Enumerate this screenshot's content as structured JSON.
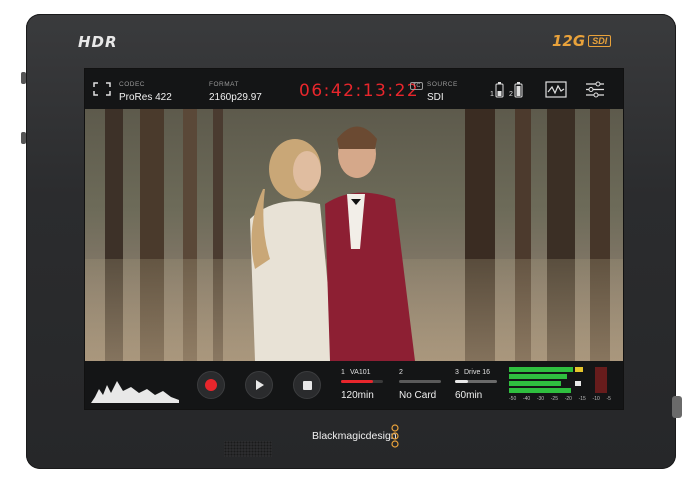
{
  "device": {
    "hdr_label": "HDR",
    "badge_12g": "12G",
    "badge_sdi": "SDI",
    "brand_name": "Blackmagicdesign"
  },
  "topbar": {
    "codec_label": "CODEC",
    "codec_value": "ProRes 422",
    "format_label": "FORMAT",
    "format_value": "2160p29.97",
    "timecode": "06:42:13:22",
    "tc_badge": "TC",
    "source_label": "SOURCE",
    "source_value": "SDI",
    "battery_1": "1",
    "battery_2": "2",
    "icons": [
      "fullscreen-icon",
      "battery-icon",
      "scope-icon",
      "settings-sliders-icon"
    ]
  },
  "transport": {
    "icons": [
      "record-icon",
      "play-icon",
      "stop-icon"
    ],
    "record_color": "#e8262c"
  },
  "slots": [
    {
      "number": "1",
      "name": "VA101",
      "time": "120min",
      "bar_color": "#e8262c",
      "fill": 0.75
    },
    {
      "number": "2",
      "name": "",
      "time": "No Card",
      "bar_color": "#8a8a8a",
      "fill": 0.0
    },
    {
      "number": "3",
      "name": "Drive 16",
      "time": "60min",
      "bar_color": "#d8d8d8",
      "fill": 0.3
    }
  ],
  "meters": {
    "scale": [
      "-50",
      "-40",
      "-30",
      "-25",
      "-20",
      "-15",
      "-10",
      "-5"
    ]
  }
}
